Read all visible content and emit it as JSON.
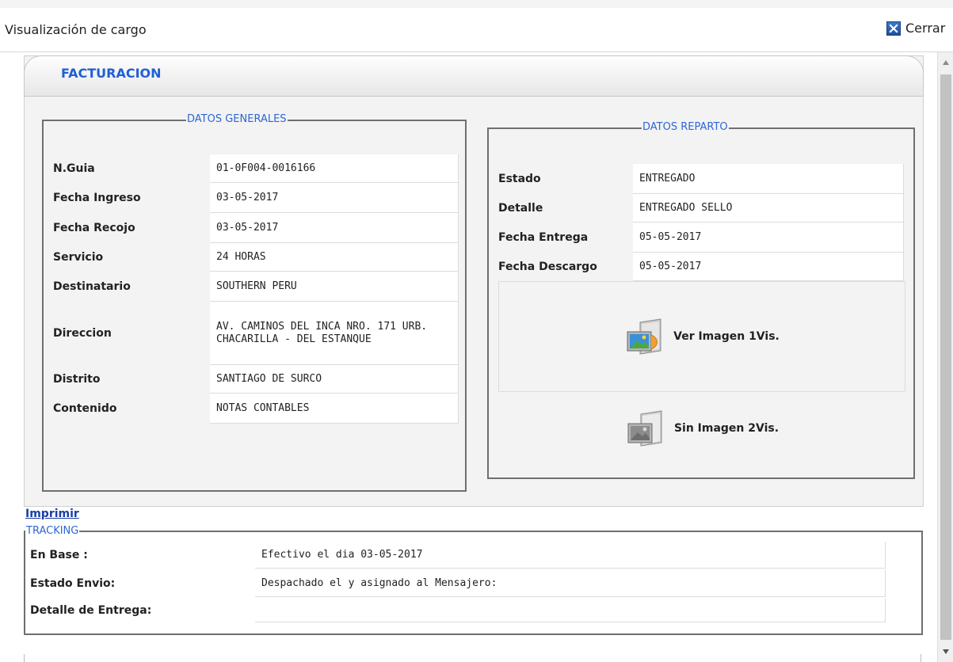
{
  "window": {
    "title": "Visualización de cargo",
    "close_label": "Cerrar"
  },
  "panel": {
    "title": "FACTURACION"
  },
  "datos_generales": {
    "legend": "DATOS GENERALES",
    "rows": [
      {
        "label": "N.Guia",
        "value": "01-0F004-0016166"
      },
      {
        "label": "Fecha Ingreso",
        "value": "03-05-2017"
      },
      {
        "label": "Fecha Recojo",
        "value": "03-05-2017"
      },
      {
        "label": "Servicio",
        "value": "24 HORAS"
      },
      {
        "label": "Destinatario",
        "value": "SOUTHERN PERU"
      },
      {
        "label": "Direccion",
        "value": "AV. CAMINOS DEL INCA NRO. 171 URB. CHACARILLA - DEL ESTANQUE"
      },
      {
        "label": "Distrito",
        "value": "SANTIAGO DE SURCO"
      },
      {
        "label": "Contenido",
        "value": "NOTAS CONTABLES"
      }
    ]
  },
  "datos_reparto": {
    "legend": "DATOS REPARTO",
    "rows": [
      {
        "label": "Estado",
        "value": "ENTREGADO"
      },
      {
        "label": "Detalle",
        "value": "ENTREGADO SELLO"
      },
      {
        "label": "Fecha Entrega",
        "value": "05-05-2017"
      },
      {
        "label": "Fecha Descargo",
        "value": "05-05-2017"
      }
    ],
    "image1_label": "Ver Imagen 1Vis.",
    "image2_label": "Sin Imagen 2Vis."
  },
  "print_label": "Imprimir",
  "tracking": {
    "legend": "TRACKING",
    "rows": [
      {
        "label": "En Base :",
        "value": "Efectivo el dia 03-05-2017"
      },
      {
        "label": "Estado Envio:",
        "value": "Despachado el y asignado al Mensajero:"
      },
      {
        "label": "Detalle de Entrega:",
        "value": ""
      }
    ]
  },
  "colors": {
    "accent_blue": "#1f5fd6",
    "legend_blue": "#2e66d4",
    "link_blue": "#1a3fa6",
    "panel_bg": "#f3f3f3"
  },
  "icons": {
    "close": "close-x-icon",
    "image_available": "image-viewer-icon",
    "image_unavailable": "image-viewer-gray-icon"
  }
}
